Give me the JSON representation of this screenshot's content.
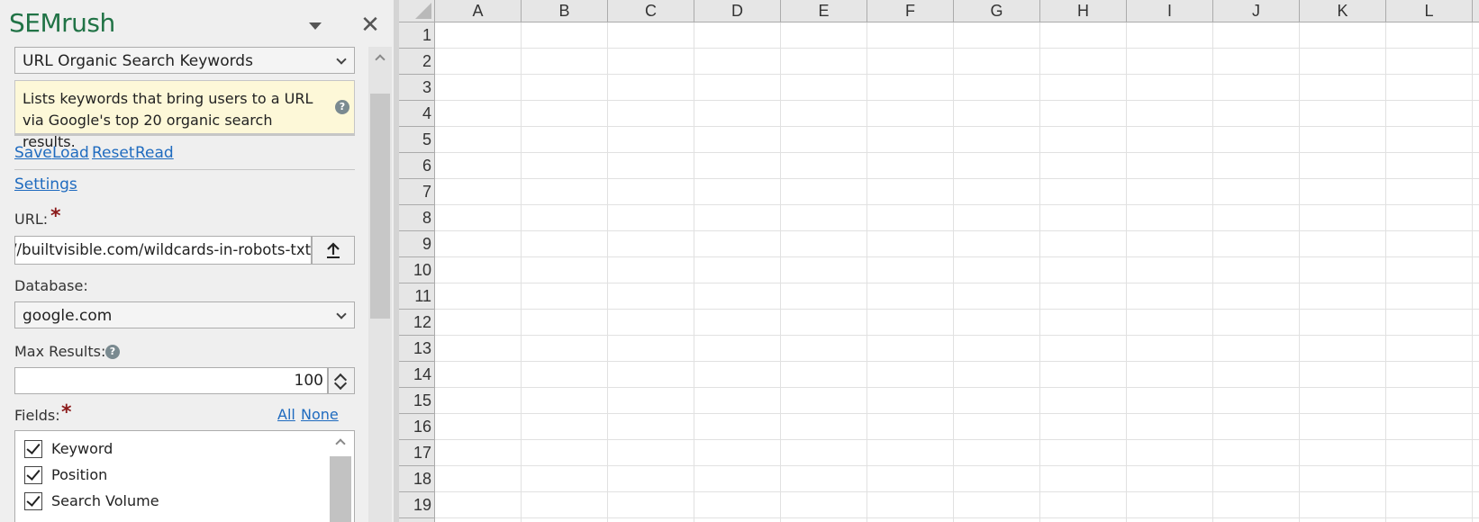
{
  "pane": {
    "title": "SEMrush",
    "report_select": "URL Organic Search Keywords",
    "report_description": "Lists keywords that bring users to a URL via Google's top 20 organic search results.",
    "help_glyph": "?",
    "actions": {
      "save": "Save",
      "load": "Load",
      "reset": "Reset",
      "read": "Read"
    },
    "settings_link": "Settings",
    "url_label": "URL:",
    "url_value": "//builtvisible.com/wildcards-in-robots-txt/",
    "database_label": "Database:",
    "database_value": "google.com",
    "max_results_label": "Max Results:",
    "max_results_value": "100",
    "fields_label": "Fields:",
    "fields_all": "All",
    "fields_none": "None",
    "required_mark": "*",
    "fields": [
      {
        "label": "Keyword",
        "checked": true
      },
      {
        "label": "Position",
        "checked": true
      },
      {
        "label": "Search Volume",
        "checked": true
      }
    ]
  },
  "sheet": {
    "columns": [
      "A",
      "B",
      "C",
      "D",
      "E",
      "F",
      "G",
      "H",
      "I",
      "J",
      "K",
      "L"
    ],
    "rows": [
      "1",
      "2",
      "3",
      "4",
      "5",
      "6",
      "7",
      "8",
      "9",
      "10",
      "11",
      "12",
      "13",
      "14",
      "15",
      "16",
      "17",
      "18",
      "19"
    ]
  },
  "colors": {
    "accent": "#217346",
    "link": "#1f6bbf",
    "required": "#8b1a1a",
    "description_bg": "#fdf8d8"
  }
}
